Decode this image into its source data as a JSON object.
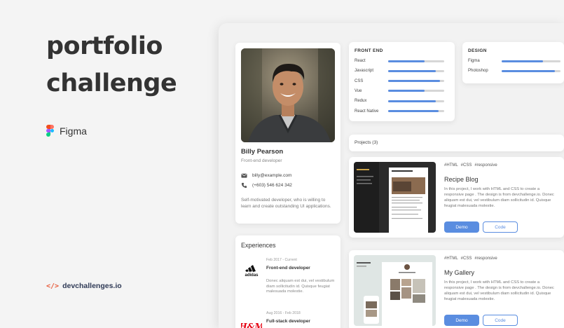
{
  "promo": {
    "title_line1": "portfolio",
    "title_line2": "challenge",
    "tool": "Figma",
    "brand": "devchallenges.io",
    "brand_icon": "code-icon"
  },
  "colors": {
    "accent": "#5a8de0",
    "bar_track": "#d6d6d6",
    "brand_orange": "#e85d3c"
  },
  "profile": {
    "name": "Billy Pearson",
    "role": "Front-end developer",
    "email": "billy@example.com",
    "phone": "(+603) 546 624 342",
    "bio": "Self-motivated developer, who is willing to learn and create outstanding UI applications."
  },
  "front_end": {
    "heading": "FRONT END",
    "skills": [
      {
        "label": "React",
        "level": 0.65
      },
      {
        "label": "Javascript",
        "level": 0.85
      },
      {
        "label": "CSS",
        "level": 0.92
      },
      {
        "label": "Vue",
        "level": 0.65
      },
      {
        "label": "Redux",
        "level": 0.85
      },
      {
        "label": "React Native",
        "level": 0.9
      }
    ]
  },
  "design": {
    "heading": "DESIGN",
    "skills": [
      {
        "label": "Figma",
        "level": 0.7
      },
      {
        "label": "Photoshop",
        "level": 0.9
      }
    ]
  },
  "projects": {
    "header": "Projects (3)",
    "items": [
      {
        "tags": [
          "#HTML",
          "#CSS",
          "#responsive"
        ],
        "title": "Recipe Blog",
        "description": "In this project, I work with HTML and CSS to create a responsive page . The design is from devchallenge.io. Donec aliquam est dui, vel vestibulum diam sollicitudin id. Quisque feugiat malesuada molestie.",
        "demo_label": "Demo",
        "code_label": "Code"
      },
      {
        "tags": [
          "#HTML",
          "#CSS",
          "#responsive"
        ],
        "title": "My Gallery",
        "description": "In this project, I work with HTML and CSS to create a responsive page . The design is from devchallenge.io. Donec aliquam est dui, vel vestibulum diam sollicitudin id. Quisque feugiat malesuada molestie.",
        "demo_label": "Demo",
        "code_label": "Code"
      }
    ]
  },
  "experiences": {
    "heading": "Experiences",
    "items": [
      {
        "logo": "adidas-logo",
        "logo_text": "adidas",
        "date": "Feb 2017 - Current",
        "title": "Front-end developer",
        "description": "Donec aliquam est dui, vel vestibulum diam sollicitudin id. Quisque feugiat malesuada molestie."
      },
      {
        "logo": "hm-logo",
        "logo_text": "H&M",
        "date": "Aug 2016 - Feb 2018",
        "title": "Full-stack developer"
      }
    ]
  }
}
